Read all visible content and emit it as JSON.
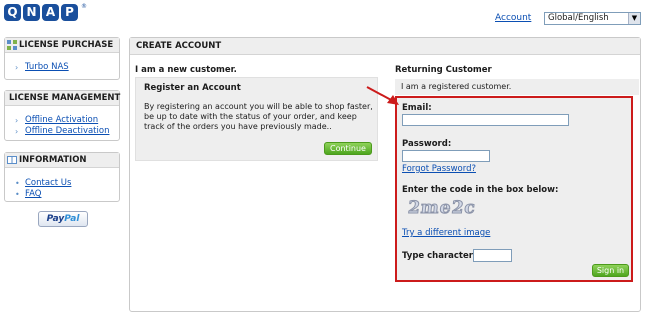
{
  "header": {
    "logo_text": "QNAP",
    "logo_letters": [
      "Q",
      "N",
      "A",
      "P"
    ],
    "logo_mark": "®",
    "account_link": "Account",
    "language_select": "Global/English",
    "brand_color": "#1a4f9c"
  },
  "sidebar": {
    "license_purchase": {
      "title": "LICENSE PURCHASE",
      "icon": "grid-icon",
      "items": [
        "Turbo NAS"
      ]
    },
    "license_management": {
      "title": "LICENSE MANAGEMENT",
      "icon": "grid-icon",
      "items": [
        "Offline Activation",
        "Offline Deactivation"
      ]
    },
    "information": {
      "title": "INFORMATION",
      "icon": "book-icon",
      "items": [
        "Contact Us",
        "FAQ"
      ]
    },
    "paypal_logo": {
      "pay": "Pay",
      "pal": "Pal"
    }
  },
  "main": {
    "title": "CREATE ACCOUNT",
    "new_customer": {
      "heading": "I am a new customer.",
      "box_title": "Register an Account",
      "text": "By registering an account you will be able to shop faster, be up to date with the status of your order, and keep track of the orders you have previously made..",
      "continue_button": "Continue"
    },
    "returning_customer": {
      "heading": "Returning Customer",
      "subtitle": "I am a registered customer.",
      "email_label": "Email:",
      "email_value": "",
      "password_label": "Password:",
      "password_value": "",
      "forgot_password": "Forgot Password?",
      "captcha_prompt": "Enter the code in the box below:",
      "captcha_text": "2me2c",
      "different_image": "Try a different image",
      "type_characters_label": "Type characters:",
      "type_characters_value": "",
      "sign_in_button": "Sign in"
    }
  },
  "colors": {
    "link": "#0b4fb3",
    "button_green": "#4ea61f",
    "highlight_red": "#cc1b1b",
    "panel_gray": "#eeeeee"
  }
}
